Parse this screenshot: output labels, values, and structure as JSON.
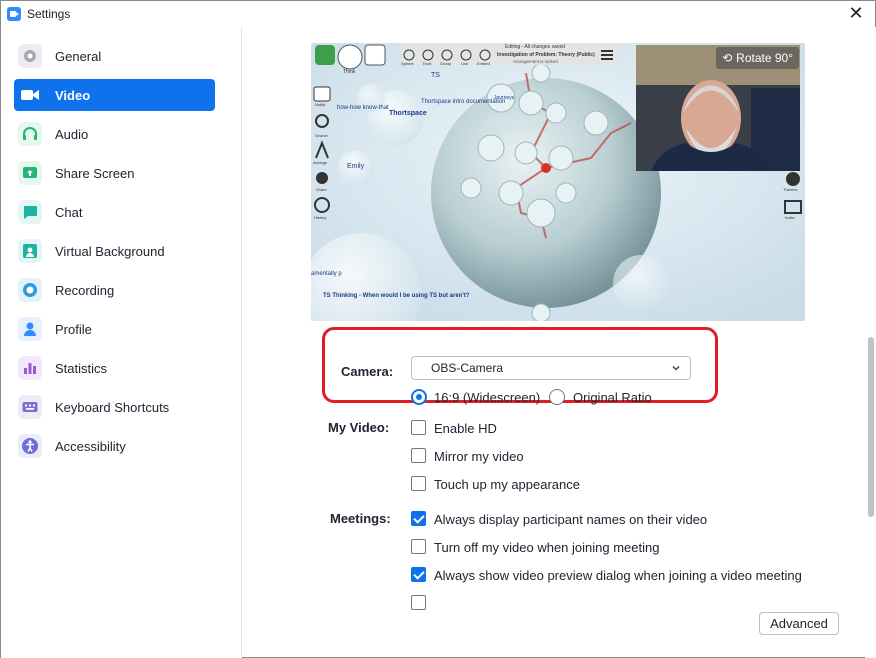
{
  "window": {
    "title": "Settings"
  },
  "sidebar": {
    "items": [
      {
        "label": "General",
        "icon": "gear-icon",
        "color": "#a8a8b0",
        "active": false
      },
      {
        "label": "Video",
        "icon": "video-camera-icon",
        "color": "#0e72ed",
        "active": true
      },
      {
        "label": "Audio",
        "icon": "headphones-icon",
        "color": "#23b574",
        "active": false
      },
      {
        "label": "Share Screen",
        "icon": "share-screen-icon",
        "color": "#23b574",
        "active": false
      },
      {
        "label": "Chat",
        "icon": "chat-bubble-icon",
        "color": "#1bb3a3",
        "active": false
      },
      {
        "label": "Virtual Background",
        "icon": "virtual-background-icon",
        "color": "#1bb3a3",
        "active": false
      },
      {
        "label": "Recording",
        "icon": "recording-icon",
        "color": "#2d9cdb",
        "active": false
      },
      {
        "label": "Profile",
        "icon": "person-icon",
        "color": "#2d8cff",
        "active": false
      },
      {
        "label": "Statistics",
        "icon": "bar-chart-icon",
        "color": "#9b59d0",
        "active": false
      },
      {
        "label": "Keyboard Shortcuts",
        "icon": "keyboard-icon",
        "color": "#7b6fd0",
        "active": false
      },
      {
        "label": "Accessibility",
        "icon": "accessibility-icon",
        "color": "#6e6ed8",
        "active": false
      }
    ]
  },
  "preview": {
    "rotate_label": "Rotate 90°",
    "toolbar_labels": [
      "Think",
      "Sphere",
      "Thort",
      "Group",
      "Link",
      "Embed"
    ],
    "header_status": "Editing - All changes saved",
    "header_title": "Investigation of Problem: Theory (Public)",
    "header_sub": "Arrangement is locked",
    "left_labels": [
      "Notify",
      "Search",
      "Arrange",
      "Share",
      "History"
    ],
    "right_labels": [
      "Themes",
      "Invite"
    ],
    "canvas_texts": [
      "Thortspace",
      "Thortspace intro documentation",
      "how-how know-that",
      "TS",
      "Emily",
      "Journeys",
      "TS Thinking - When would I be using TS but aren't?",
      "amentally p"
    ]
  },
  "camera": {
    "label": "Camera:",
    "selected": "OBS-Camera",
    "ratio_options": [
      {
        "label": "16:9 (Widescreen)",
        "selected": true
      },
      {
        "label": "Original Ratio",
        "selected": false
      }
    ]
  },
  "my_video": {
    "label": "My Video:",
    "options": [
      {
        "label": "Enable HD",
        "checked": false
      },
      {
        "label": "Mirror my video",
        "checked": false
      },
      {
        "label": "Touch up my appearance",
        "checked": false
      }
    ]
  },
  "meetings": {
    "label": "Meetings:",
    "options": [
      {
        "label": "Always display participant names on their video",
        "checked": true
      },
      {
        "label": "Turn off my video when joining meeting",
        "checked": false
      },
      {
        "label": "Always show video preview dialog when joining a video meeting",
        "checked": true
      }
    ]
  },
  "footer": {
    "advanced_label": "Advanced"
  },
  "colors": {
    "accent": "#0e72ed",
    "highlight_border": "#e01e25"
  }
}
